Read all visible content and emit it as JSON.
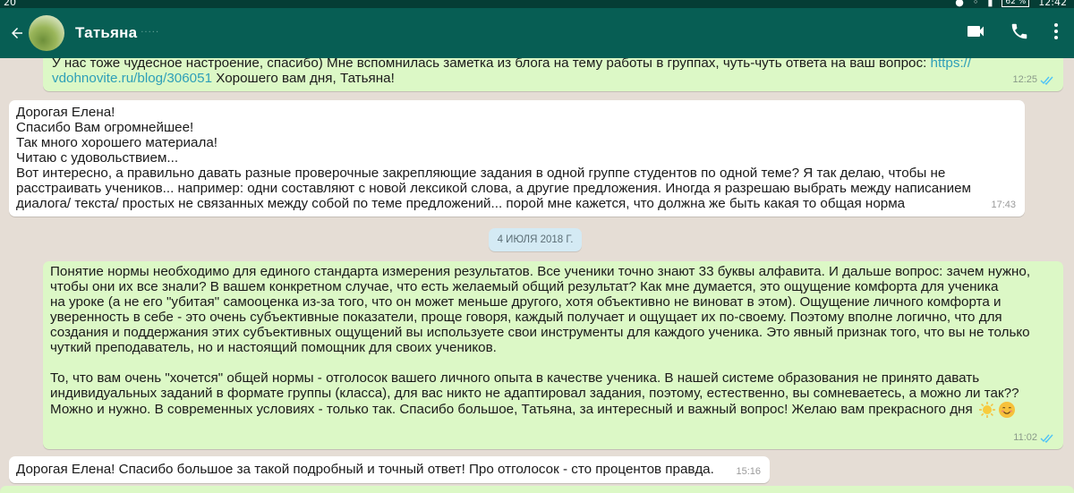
{
  "status_bar": {
    "left": "20",
    "time": "12:42",
    "battery": "62 %"
  },
  "header": {
    "contact_name": "Татьяна",
    "contact_extra": "....."
  },
  "messages": [
    {
      "direction": "out",
      "lines": [
        "У нас тоже чудесное настроение, спасибо) Мне вспомнилась заметка из блога на тему работы в группах, чуть-чуть ответа на ваш вопрос: ",
        "https://",
        "vdohnovite.ru/blog/306051",
        " Хорошего вам дня, Татьяна!"
      ],
      "time": "12:25"
    },
    {
      "direction": "in",
      "lines": [
        "Дорогая Елена!",
        "Спасибо Вам огромнейшее!",
        "Так много хорошего материала!",
        "Читаю с удовольствием...",
        "Вот интересно, а правильно давать разные проверочные закрепляющие задания в одной группе студентов по одной теме? Я так делаю, чтобы не",
        "расстраивать учеников... например: одни составляют с новой лексикой слова, а другие предложения. Иногда я разрешаю выбрать между написанием",
        "диалога/ текста/ простых не связанных между собой по теме предложений... порой мне кажется, что должна же быть какая то общая норма"
      ],
      "time": "17:43"
    },
    {
      "direction": "date",
      "label": "4 ИЮЛЯ 2018 Г."
    },
    {
      "direction": "out",
      "lines": [
        "Понятие нормы необходимо для единого стандарта измерения результатов. Все ученики точно знают 33 буквы алфавита. И дальше вопрос: зачем нужно,",
        "чтобы они их все знали? В вашем конкретном случае, что есть желаемый общий результат? Как мне думается, это ощущение комфорта для ученика",
        "на уроке (а не его \"убитая\" самооценка из-за того, что он может меньше другого, хотя объективно не виноват в этом). Ощущение личного комфорта и",
        "уверенность в себе - это очень субъективные показатели, проще говоря, каждый получает и ощущает их по-своему. Поэтому вполне логично, что для",
        "создания и поддержания этих субъективных ощущений вы используете свои инструменты для каждого ученика. Это явный признак того, что вы не только",
        "чуткий преподаватель, но и настоящий помощник для своих учеников.",
        "",
        "То, что вам очень \"хочется\" общей нормы - отголосок вашего личного опыта в качестве ученика. В нашей системе образования не принято давать",
        "индивидуальных заданий в формате группы (класса), для вас никто не адаптировал задания, поэтому, естественно, вы сомневаетесь, а можно ли так??",
        "Можно и нужно. В современных условиях - только так. Спасибо большое, Татьяна, за интересный и важный вопрос! Желаю вам прекрасного дня"
      ],
      "emoji": [
        "sun-emoji",
        "smiling-face-emoji"
      ],
      "time": "11:02"
    },
    {
      "direction": "in",
      "lines": [
        "Дорогая Елена! Спасибо большое за такой подробный и точный ответ! Про отголосок - сто процентов правда."
      ],
      "time": "15:16"
    }
  ],
  "colors": {
    "status_bar": "#053d35",
    "app_bar": "#075e54",
    "chat_bg": "#e5ddd5",
    "outgoing_bubble": "#dcf8c6",
    "incoming_bubble": "#ffffff",
    "link": "#2e9fb8",
    "read_ticks": "#4fc3f7"
  },
  "icons": [
    "back-arrow-icon",
    "video-call-icon",
    "voice-call-icon",
    "more-options-icon",
    "double-check-icon"
  ]
}
